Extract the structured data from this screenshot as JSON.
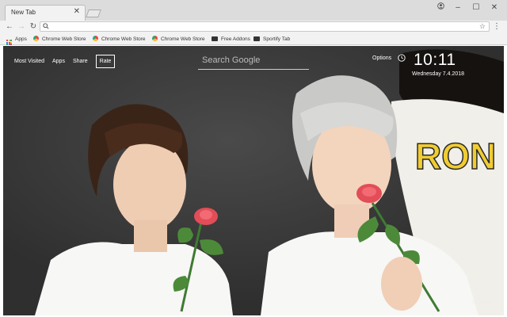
{
  "browser": {
    "tab_title": "New Tab",
    "address_value": "",
    "bookmarks": [
      {
        "label": "Apps",
        "icon": "apps-grid-icon"
      },
      {
        "label": "Chrome Web Store",
        "icon": "chrome-web-store-icon"
      },
      {
        "label": "Chrome Web Store",
        "icon": "chrome-web-store-icon"
      },
      {
        "label": "Chrome Web Store",
        "icon": "chrome-web-store-icon"
      },
      {
        "label": "Free Addons",
        "icon": "extension-icon"
      },
      {
        "label": "Sportify Tab",
        "icon": "extension-icon"
      }
    ]
  },
  "page": {
    "nav": {
      "most_visited": "Most Visited",
      "apps": "Apps",
      "share": "Share",
      "rate": "Rate"
    },
    "search": {
      "placeholder": "Search Google"
    },
    "options": "Options",
    "time": "10:11",
    "date": "Wednesday  7.4.2018",
    "support": "Support",
    "background_text": "RON"
  },
  "colors": {
    "page_background": "#3b3b3b",
    "text": "#ffffff"
  }
}
